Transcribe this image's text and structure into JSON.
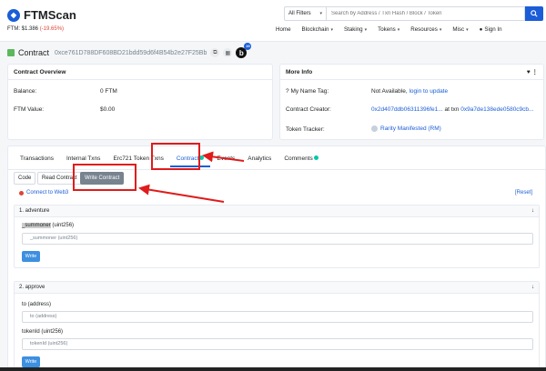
{
  "header": {
    "logo_text": "FTMScan",
    "price_label": "FTM: $1.386",
    "price_change": "(-19.65%)",
    "filter_label": "All Filters",
    "search_placeholder": "Search by Address / Txn Hash / Block / Token",
    "nav": [
      "Home",
      "Blockchain",
      "Staking",
      "Tokens",
      "Resources",
      "Misc",
      "Sign In"
    ]
  },
  "page": {
    "title": "Contract",
    "address": "0xce761D788DF608BD21bdd59d6f4B54b2e27F25Bb",
    "b_badge": "19"
  },
  "overview": {
    "title": "Contract Overview",
    "balance_label": "Balance:",
    "balance_value": "0 FTM",
    "value_label": "FTM Value:",
    "value_value": "$0.00"
  },
  "more_info": {
    "title": "More Info",
    "name_tag_label": "My Name Tag:",
    "name_tag_value": "Not Available,",
    "name_tag_link": "login to update",
    "creator_label": "Contract Creator:",
    "creator_addr": "0x2d407ddb06311396fe1...",
    "creator_at": "at txn",
    "creator_txn": "0x9a7de138ede0580c9cb...",
    "tracker_label": "Token Tracker:",
    "tracker_value": "Rarity Manifested (RM)"
  },
  "tabs": [
    "Transactions",
    "Internal Txns",
    "Erc721 Token Txns",
    "Contract",
    "Events",
    "Analytics",
    "Comments"
  ],
  "subtabs": [
    "Code",
    "Read Contract",
    "Write Contract"
  ],
  "connect_label": "Connect to Web3",
  "reset_label": "[Reset]",
  "functions": [
    {
      "title": "1. adventure",
      "params": [
        {
          "label": "_summoner",
          "type": " (uint256)",
          "placeholder": "_summoner (uint256)"
        }
      ],
      "button": "Write"
    },
    {
      "title": "2. approve",
      "params": [
        {
          "label": "to (address)",
          "type": "",
          "placeholder": "to (address)"
        },
        {
          "label": "tokenId (uint256)",
          "type": "",
          "placeholder": "tokenId (uint256)"
        }
      ],
      "button": "Write"
    }
  ],
  "colors": {
    "accent": "#1b5dd8",
    "highlight": "#e01b1b",
    "success": "#00c9a7"
  }
}
